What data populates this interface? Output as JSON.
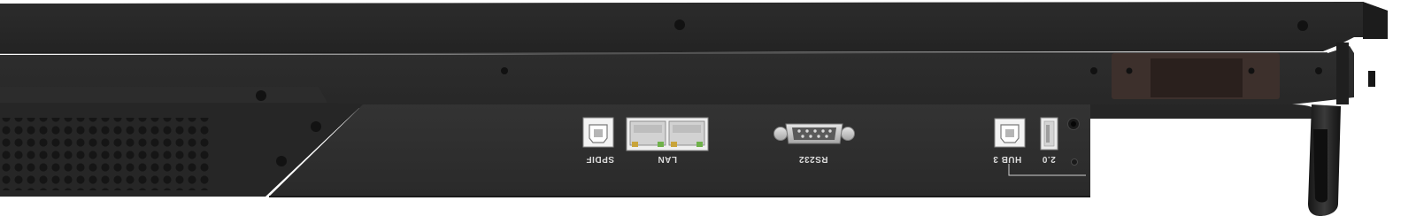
{
  "panel": {
    "ports": {
      "spdif": "SPDIF",
      "lan": "LAN",
      "rs232": "RS232",
      "hub": "HUB 3",
      "usb": "2.0"
    }
  }
}
